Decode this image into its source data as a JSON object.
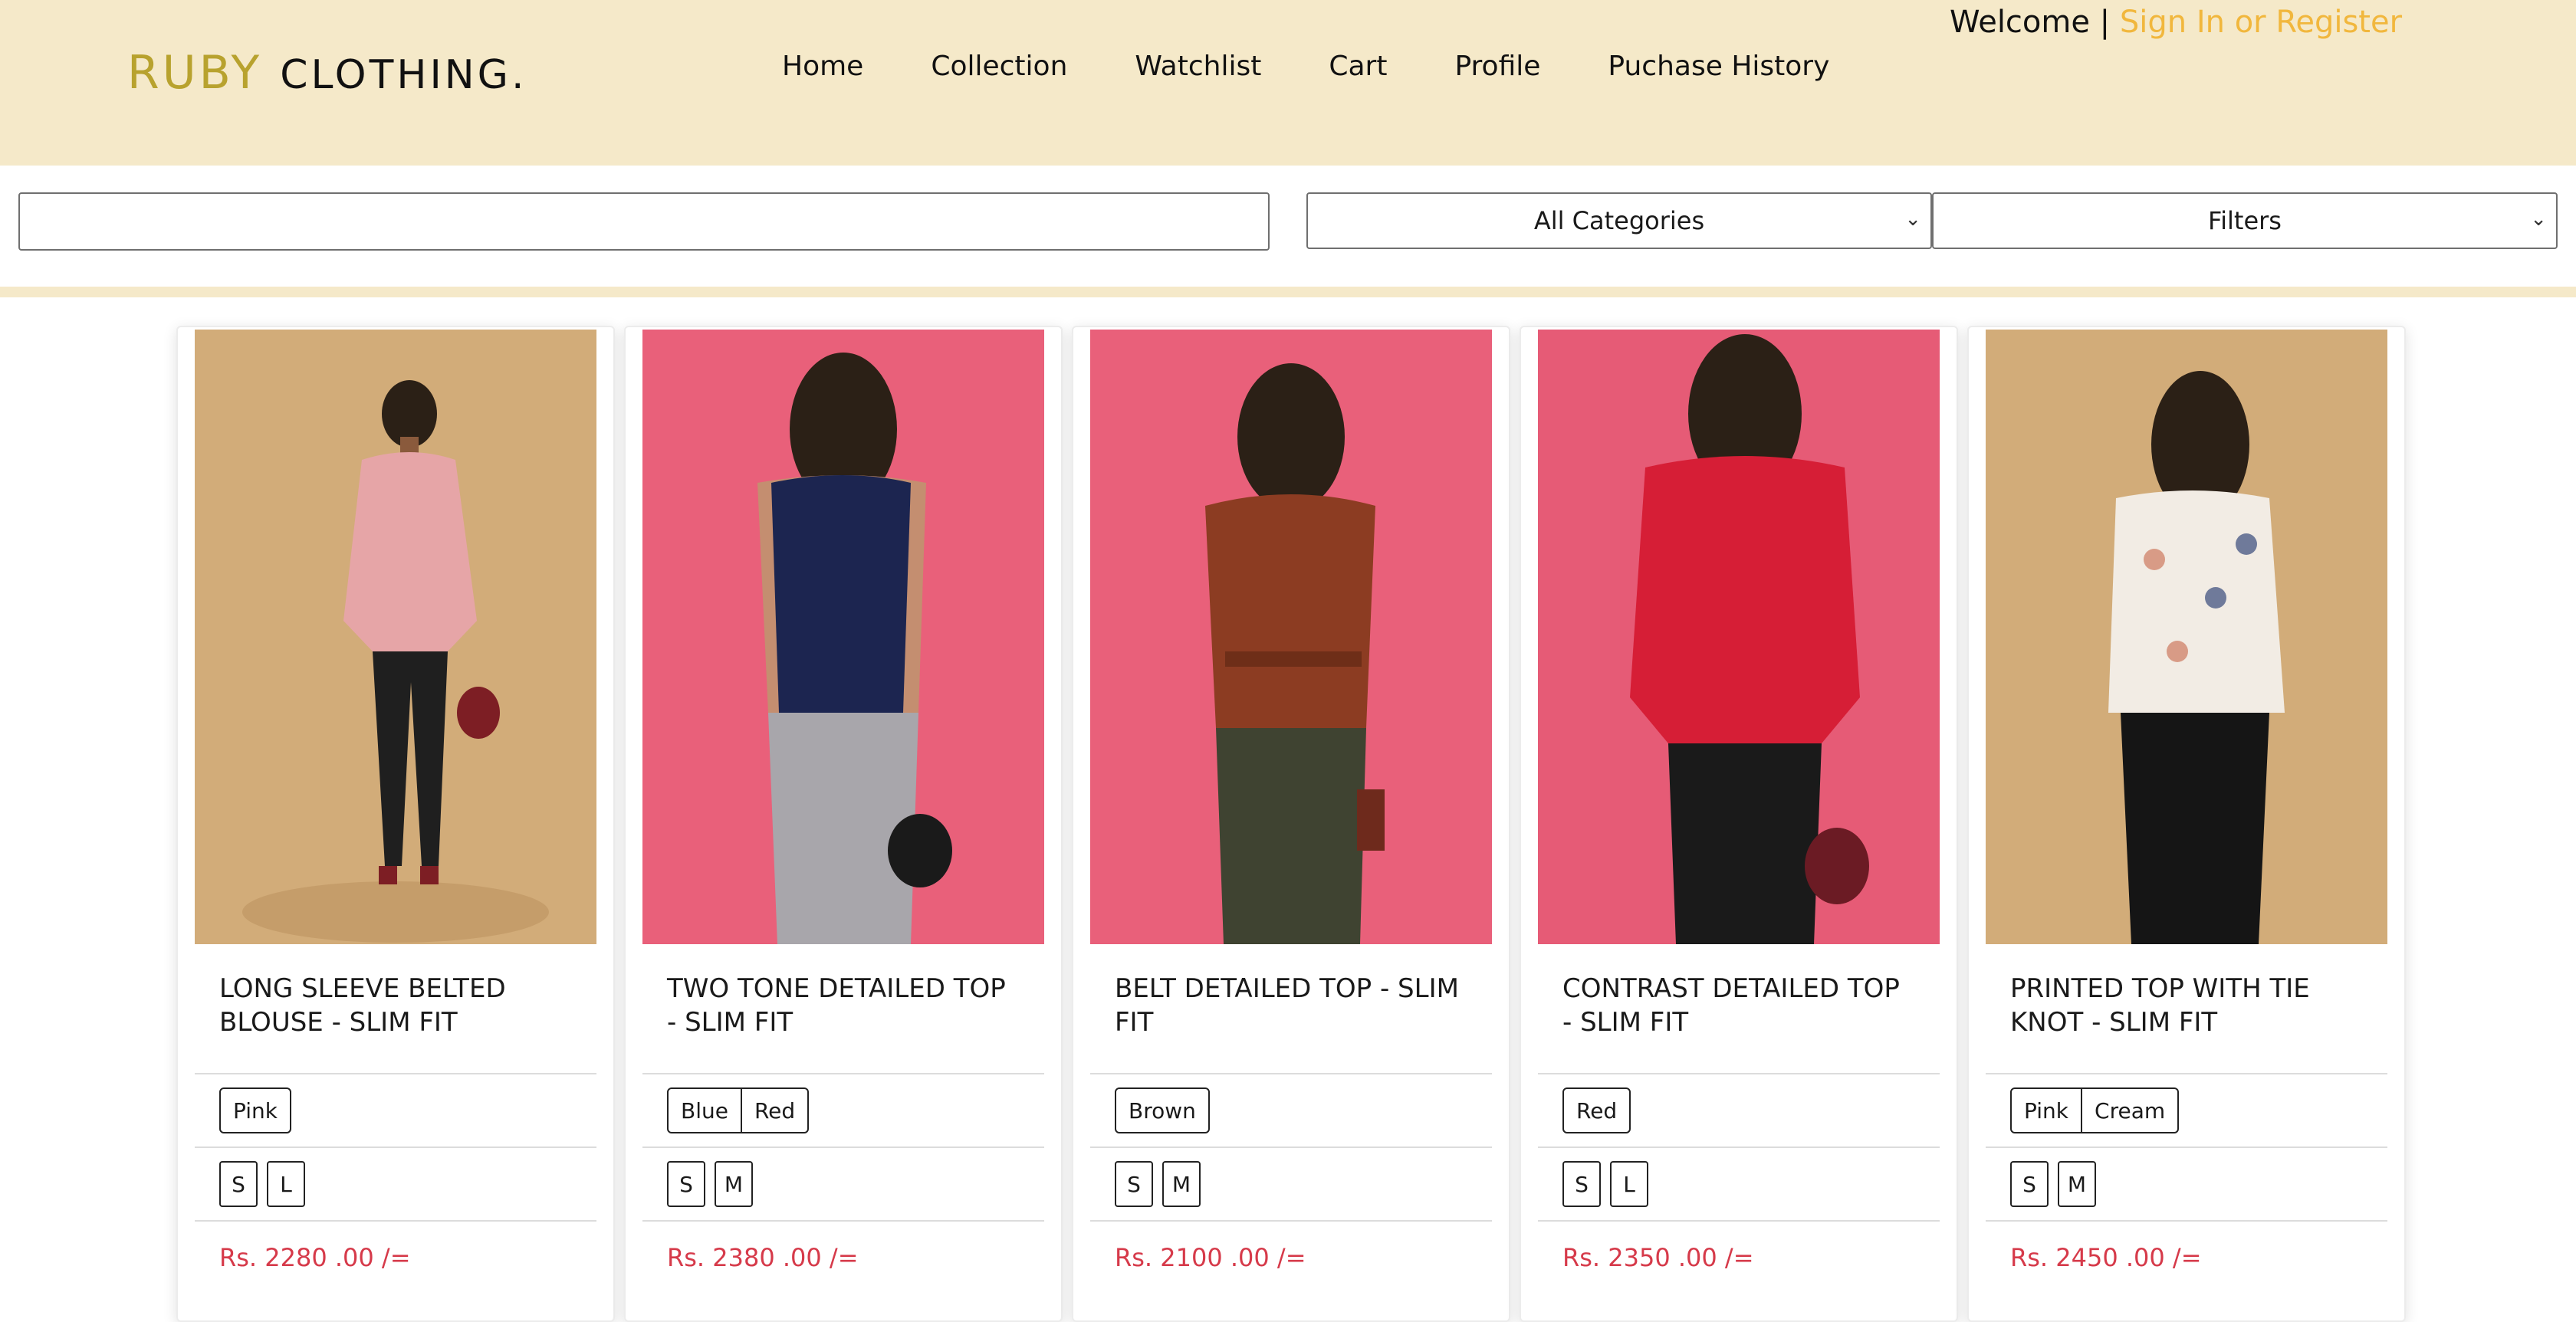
{
  "header": {
    "brand_first": "RUBY",
    "brand_second": "CLOTHING.",
    "nav": [
      "Home",
      "Collection",
      "Watchlist",
      "Cart",
      "Profile",
      "Puchase History"
    ],
    "welcome": "Welcome | ",
    "signin": "Sign In or Register"
  },
  "search": {
    "placeholder": "",
    "category": "All Categories",
    "filters": "Filters"
  },
  "colors": {
    "header_bg": "#f5e9c9",
    "brand_accent": "#b8a22e",
    "signin": "#f1b73d",
    "price": "#d63a4a"
  },
  "products": [
    {
      "title": "LONG SLEEVE BELTED BLOUSE - SLIM FIT",
      "colors": [
        "Pink"
      ],
      "sizes": [
        "S",
        "L"
      ],
      "price": "Rs. 2280 .00 /=",
      "bg": "#d2ac79",
      "top": "#e6a5a7",
      "bottom": "#1f1f1f",
      "hair": "#2b2016"
    },
    {
      "title": "TWO TONE DETAILED TOP - SLIM FIT",
      "colors": [
        "Blue",
        "Red"
      ],
      "sizes": [
        "S",
        "M"
      ],
      "price": "Rs. 2380 .00 /=",
      "bg": "#e9607a",
      "top": "#1c2550",
      "bottom": "#a8a6ab",
      "hair": "#2b2016"
    },
    {
      "title": "BELT DETAILED TOP - SLIM FIT",
      "colors": [
        "Brown"
      ],
      "sizes": [
        "S",
        "M"
      ],
      "price": "Rs. 2100 .00 /=",
      "bg": "#e9607a",
      "top": "#8c3c22",
      "bottom": "#3f4331",
      "hair": "#2b2016"
    },
    {
      "title": "CONTRAST DETAILED TOP - SLIM FIT",
      "colors": [
        "Red"
      ],
      "sizes": [
        "S",
        "L"
      ],
      "price": "Rs. 2350 .00 /=",
      "bg": "#e65b76",
      "top": "#d61e36",
      "bottom": "#1a1a1a",
      "hair": "#2b2016"
    },
    {
      "title": "PRINTED TOP WITH TIE KNOT - SLIM FIT",
      "colors": [
        "Pink",
        "Cream"
      ],
      "sizes": [
        "S",
        "M"
      ],
      "price": "Rs. 2450 .00 /=",
      "bg": "#d2ac79",
      "top": "#f2ece4",
      "bottom": "#151515",
      "hair": "#2b2016"
    }
  ]
}
